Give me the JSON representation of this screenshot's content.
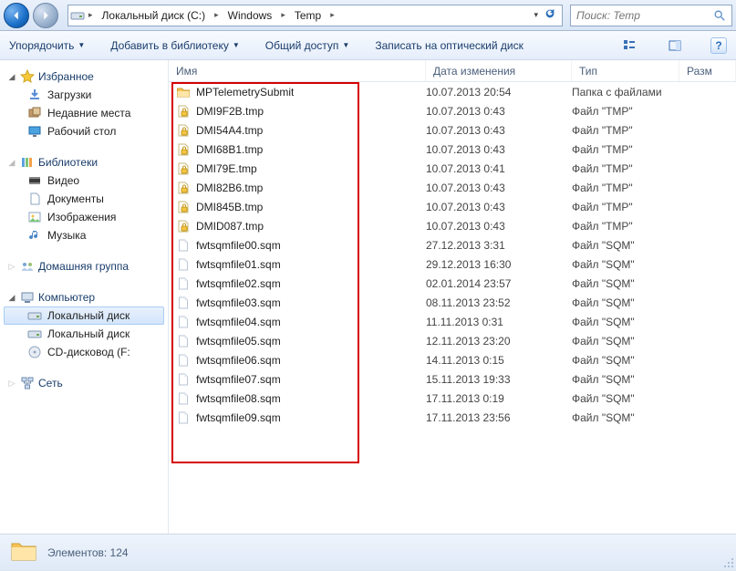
{
  "breadcrumb": {
    "items": [
      "Локальный диск (C:)",
      "Windows",
      "Temp"
    ]
  },
  "search": {
    "placeholder": "Поиск: Temp"
  },
  "toolbar": {
    "organize": "Упорядочить",
    "addlib": "Добавить в библиотеку",
    "share": "Общий доступ",
    "burn": "Записать на оптический диск"
  },
  "sidebar": {
    "favorites": {
      "label": "Избранное",
      "items": [
        "Загрузки",
        "Недавние места",
        "Рабочий стол"
      ]
    },
    "libraries": {
      "label": "Библиотеки",
      "items": [
        "Видео",
        "Документы",
        "Изображения",
        "Музыка"
      ]
    },
    "homegroup": {
      "label": "Домашняя группа"
    },
    "computer": {
      "label": "Компьютер",
      "items": [
        "Локальный диск",
        "Локальный диск",
        "CD-дисковод (F:"
      ]
    },
    "network": {
      "label": "Сеть"
    }
  },
  "columns": {
    "name": "Имя",
    "date": "Дата изменения",
    "type": "Тип",
    "size": "Разм"
  },
  "files": [
    {
      "name": "MPTelemetrySubmit",
      "date": "10.07.2013 20:54",
      "type": "Папка с файлами",
      "icon": "folder"
    },
    {
      "name": "DMI9F2B.tmp",
      "date": "10.07.2013 0:43",
      "type": "Файл \"TMP\"",
      "icon": "lock"
    },
    {
      "name": "DMI54A4.tmp",
      "date": "10.07.2013 0:43",
      "type": "Файл \"TMP\"",
      "icon": "lock"
    },
    {
      "name": "DMI68B1.tmp",
      "date": "10.07.2013 0:43",
      "type": "Файл \"TMP\"",
      "icon": "lock"
    },
    {
      "name": "DMI79E.tmp",
      "date": "10.07.2013 0:41",
      "type": "Файл \"TMP\"",
      "icon": "lock"
    },
    {
      "name": "DMI82B6.tmp",
      "date": "10.07.2013 0:43",
      "type": "Файл \"TMP\"",
      "icon": "lock"
    },
    {
      "name": "DMI845B.tmp",
      "date": "10.07.2013 0:43",
      "type": "Файл \"TMP\"",
      "icon": "lock"
    },
    {
      "name": "DMID087.tmp",
      "date": "10.07.2013 0:43",
      "type": "Файл \"TMP\"",
      "icon": "lock"
    },
    {
      "name": "fwtsqmfile00.sqm",
      "date": "27.12.2013 3:31",
      "type": "Файл \"SQM\"",
      "icon": "file"
    },
    {
      "name": "fwtsqmfile01.sqm",
      "date": "29.12.2013 16:30",
      "type": "Файл \"SQM\"",
      "icon": "file"
    },
    {
      "name": "fwtsqmfile02.sqm",
      "date": "02.01.2014 23:57",
      "type": "Файл \"SQM\"",
      "icon": "file"
    },
    {
      "name": "fwtsqmfile03.sqm",
      "date": "08.11.2013 23:52",
      "type": "Файл \"SQM\"",
      "icon": "file"
    },
    {
      "name": "fwtsqmfile04.sqm",
      "date": "11.11.2013 0:31",
      "type": "Файл \"SQM\"",
      "icon": "file"
    },
    {
      "name": "fwtsqmfile05.sqm",
      "date": "12.11.2013 23:20",
      "type": "Файл \"SQM\"",
      "icon": "file"
    },
    {
      "name": "fwtsqmfile06.sqm",
      "date": "14.11.2013 0:15",
      "type": "Файл \"SQM\"",
      "icon": "file"
    },
    {
      "name": "fwtsqmfile07.sqm",
      "date": "15.11.2013 19:33",
      "type": "Файл \"SQM\"",
      "icon": "file"
    },
    {
      "name": "fwtsqmfile08.sqm",
      "date": "17.11.2013 0:19",
      "type": "Файл \"SQM\"",
      "icon": "file"
    },
    {
      "name": "fwtsqmfile09.sqm",
      "date": "17.11.2013 23:56",
      "type": "Файл \"SQM\"",
      "icon": "file"
    }
  ],
  "status": {
    "label": "Элементов:",
    "count": "124"
  }
}
